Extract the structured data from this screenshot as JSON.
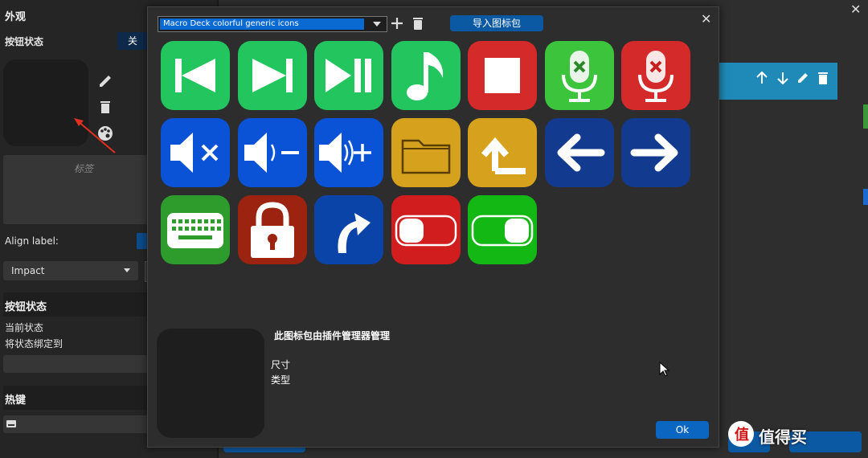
{
  "left_panel": {
    "appearance_title": "外观",
    "button_state_label": "按钮状态",
    "button_state_toggle": "关",
    "label_placeholder": "标签",
    "align_label": "Align label:",
    "font_value": "Impact",
    "section_button_state": "按钮状态",
    "current_state": "当前状态",
    "bind_state": "将状态绑定到",
    "hotkey_title": "热键"
  },
  "dialog": {
    "pack_name": "Macro Deck colorful generic icons",
    "import_label": "导入图标包",
    "managed_text": "此图标包由插件管理器管理",
    "size_label": "尺寸",
    "type_label": "类型",
    "ok_label": "Ok",
    "icons": [
      {
        "name": "skip-back-icon",
        "bg": "#22c55e"
      },
      {
        "name": "skip-forward-icon",
        "bg": "#22c55e"
      },
      {
        "name": "play-pause-icon",
        "bg": "#22c55e"
      },
      {
        "name": "music-note-icon",
        "bg": "#22c55e"
      },
      {
        "name": "stop-icon",
        "bg": "#d42a2a"
      },
      {
        "name": "mic-mute-green-icon",
        "bg": "#3cc43c"
      },
      {
        "name": "mic-mute-red-icon",
        "bg": "#d42a2a"
      },
      {
        "name": "volume-mute-icon",
        "bg": "#0a52d6"
      },
      {
        "name": "volume-down-icon",
        "bg": "#0a52d6"
      },
      {
        "name": "volume-up-icon",
        "bg": "#0a52d6"
      },
      {
        "name": "folder-icon",
        "bg": "#d6a11c"
      },
      {
        "name": "folder-up-icon",
        "bg": "#d6a11c"
      },
      {
        "name": "arrow-left-icon",
        "bg": "#123a8f"
      },
      {
        "name": "arrow-right-icon",
        "bg": "#123a8f"
      },
      {
        "name": "keyboard-icon",
        "bg": "#2d9c2d"
      },
      {
        "name": "lock-icon",
        "bg": "#9c2310"
      },
      {
        "name": "redirect-arrow-icon",
        "bg": "#0a44a8"
      },
      {
        "name": "toggle-off-icon",
        "bg": "#d11d1d"
      },
      {
        "name": "toggle-on-icon",
        "bg": "#14b814"
      }
    ]
  },
  "watermark": "值得买",
  "colors": {
    "accent": "#0b59a3",
    "highlight": "#1f8ab8"
  }
}
